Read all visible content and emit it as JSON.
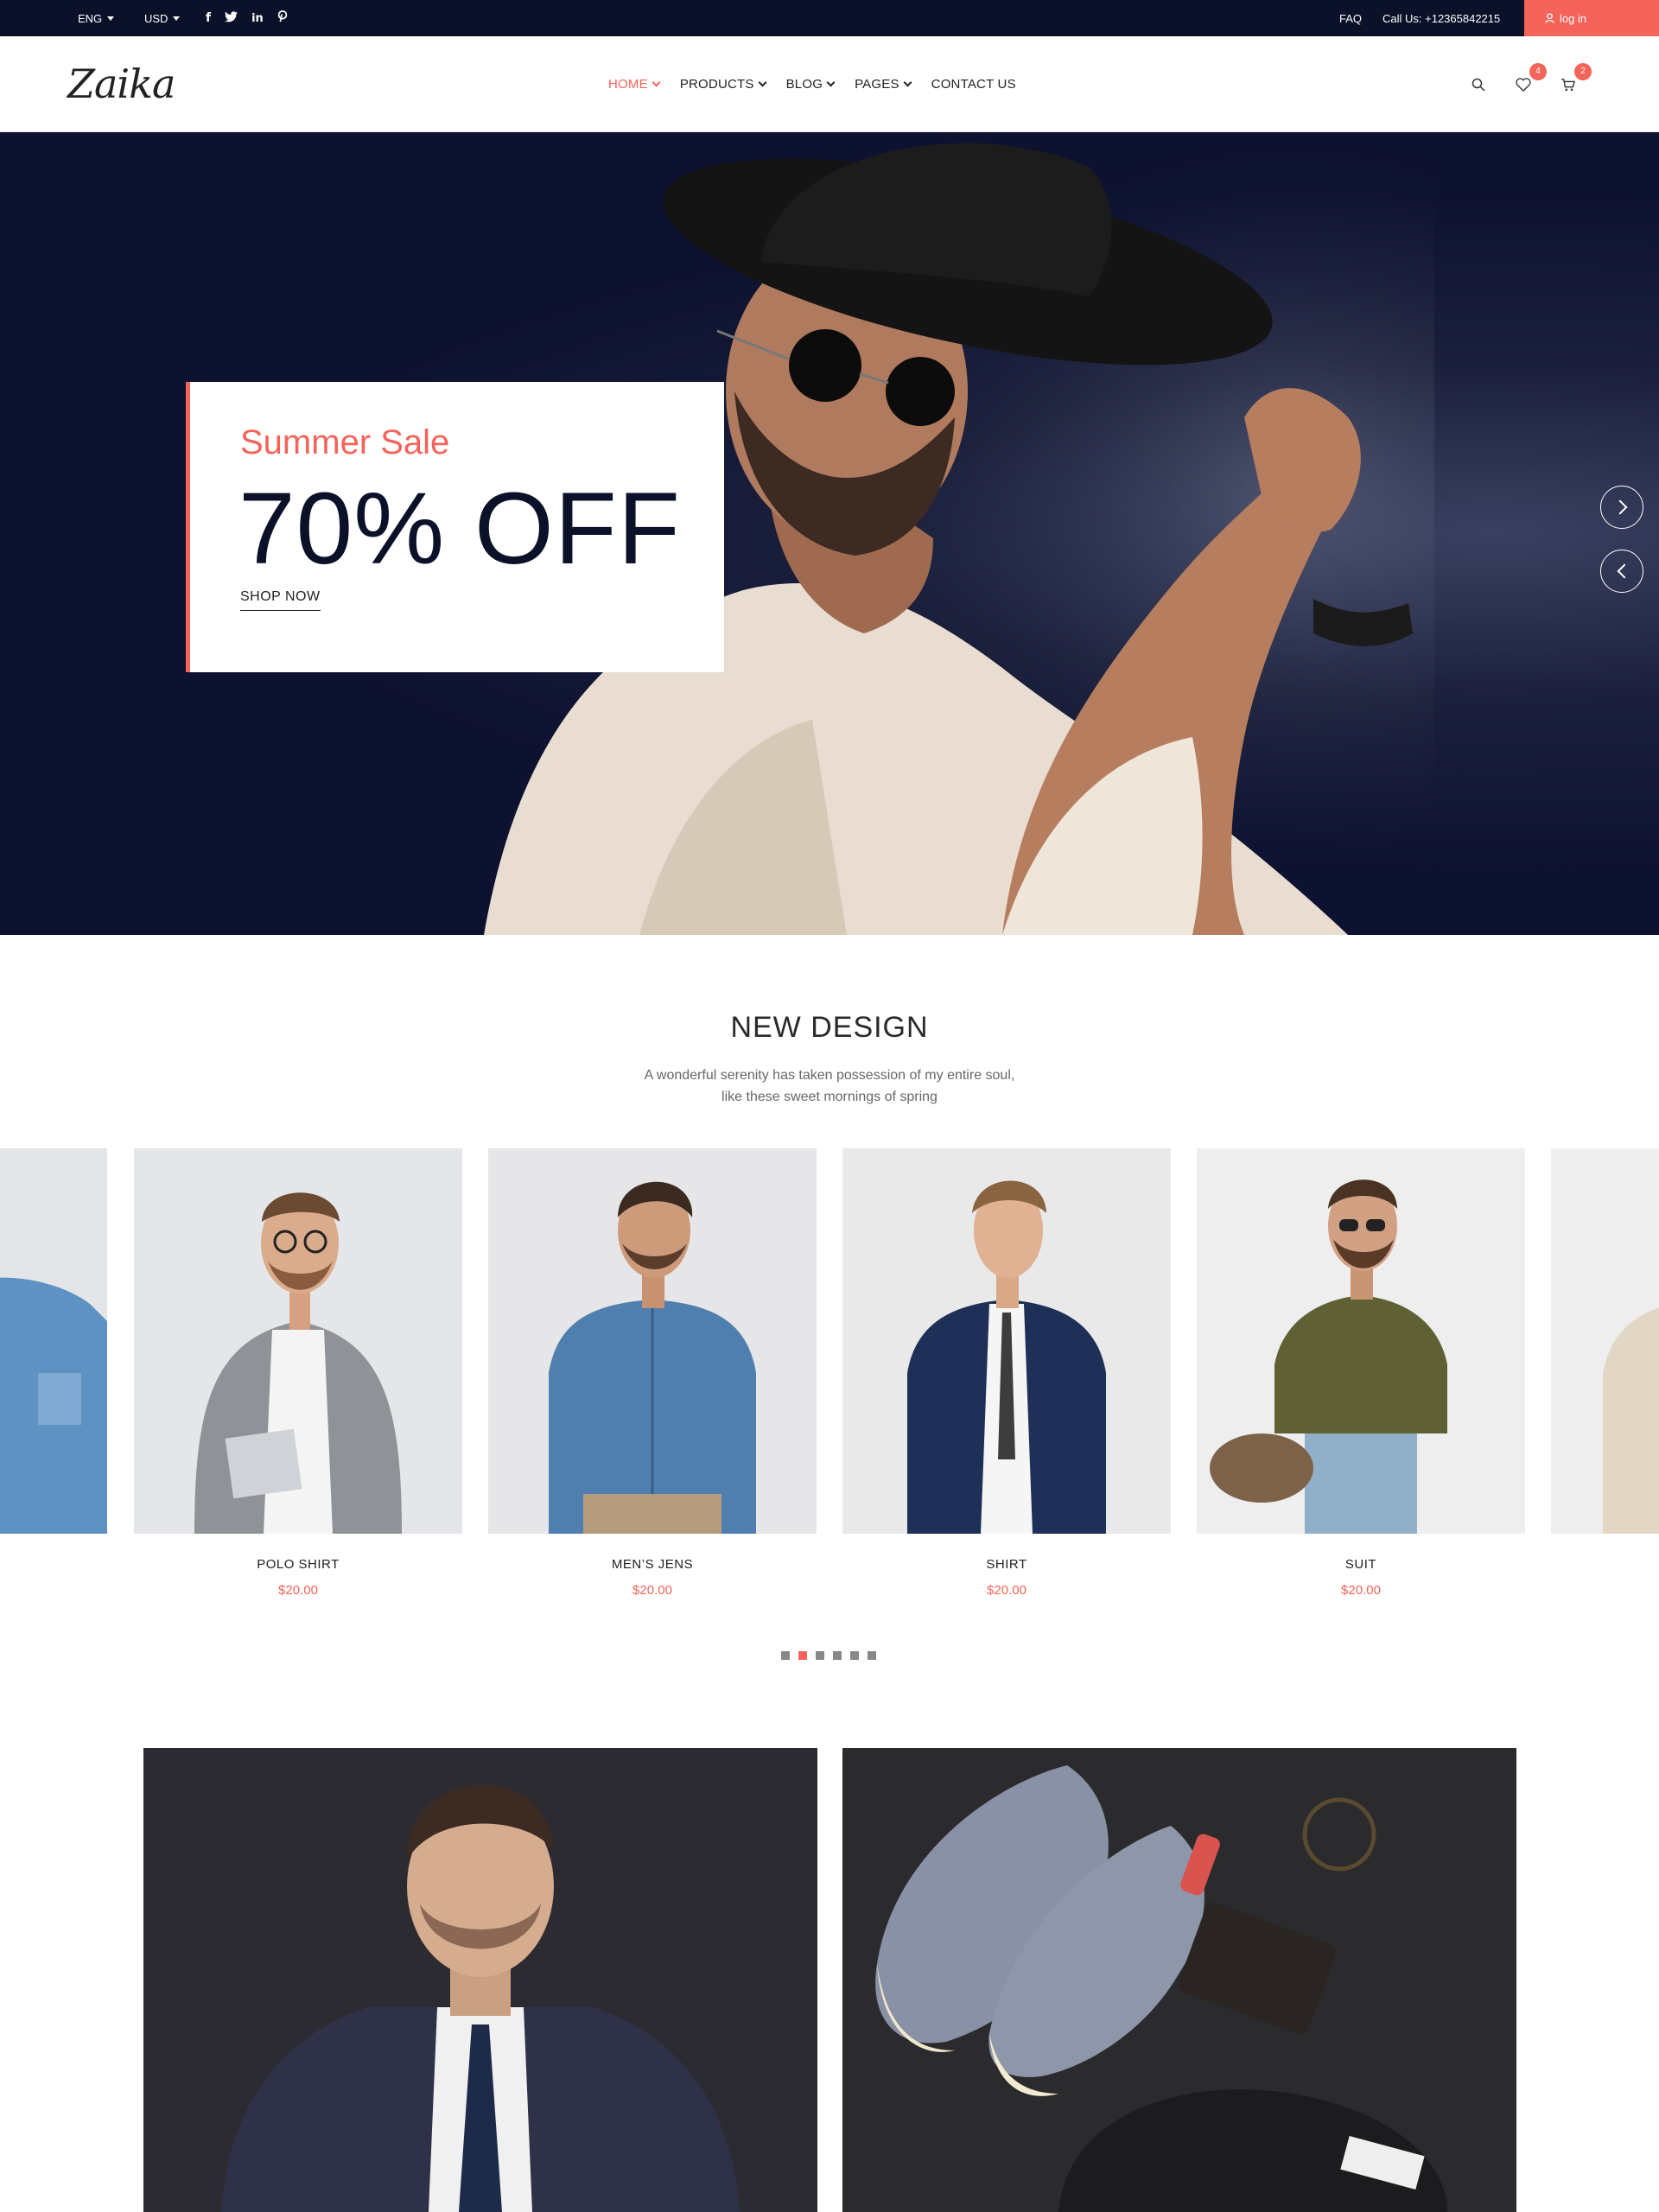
{
  "topbar": {
    "language": "ENG",
    "currency": "USD",
    "social_icons": [
      "facebook-icon",
      "twitter-icon",
      "linkedin-icon",
      "pinterest-icon"
    ],
    "faq": "FAQ",
    "call": "Call Us: +12365842215",
    "login": "log in"
  },
  "header": {
    "logo": "Zaika",
    "nav": [
      {
        "label": "HOME",
        "active": true
      },
      {
        "label": "PRODUCTS"
      },
      {
        "label": "BLOG"
      },
      {
        "label": "PAGES"
      },
      {
        "label": "CONTACT US"
      }
    ],
    "wishlist_count": "4",
    "cart_count": "2"
  },
  "hero": {
    "subtitle": "Summer Sale",
    "title": "70% OFF",
    "cta": "SHOP NOW"
  },
  "new_design": {
    "title": "NEW DESIGN",
    "desc_line1": "A wonderful serenity has taken possession of my entire soul,",
    "desc_line2": "like these sweet mornings of spring",
    "products": [
      {
        "name": "POLO SHIRT",
        "price": "$20.00"
      },
      {
        "name": "MEN’S JENS",
        "price": "$20.00"
      },
      {
        "name": "SHIRT",
        "price": "$20.00"
      },
      {
        "name": "SUIT",
        "price": "$20.00"
      }
    ]
  },
  "colors": {
    "accent": "#f4645a",
    "dark": "#0b1129"
  }
}
